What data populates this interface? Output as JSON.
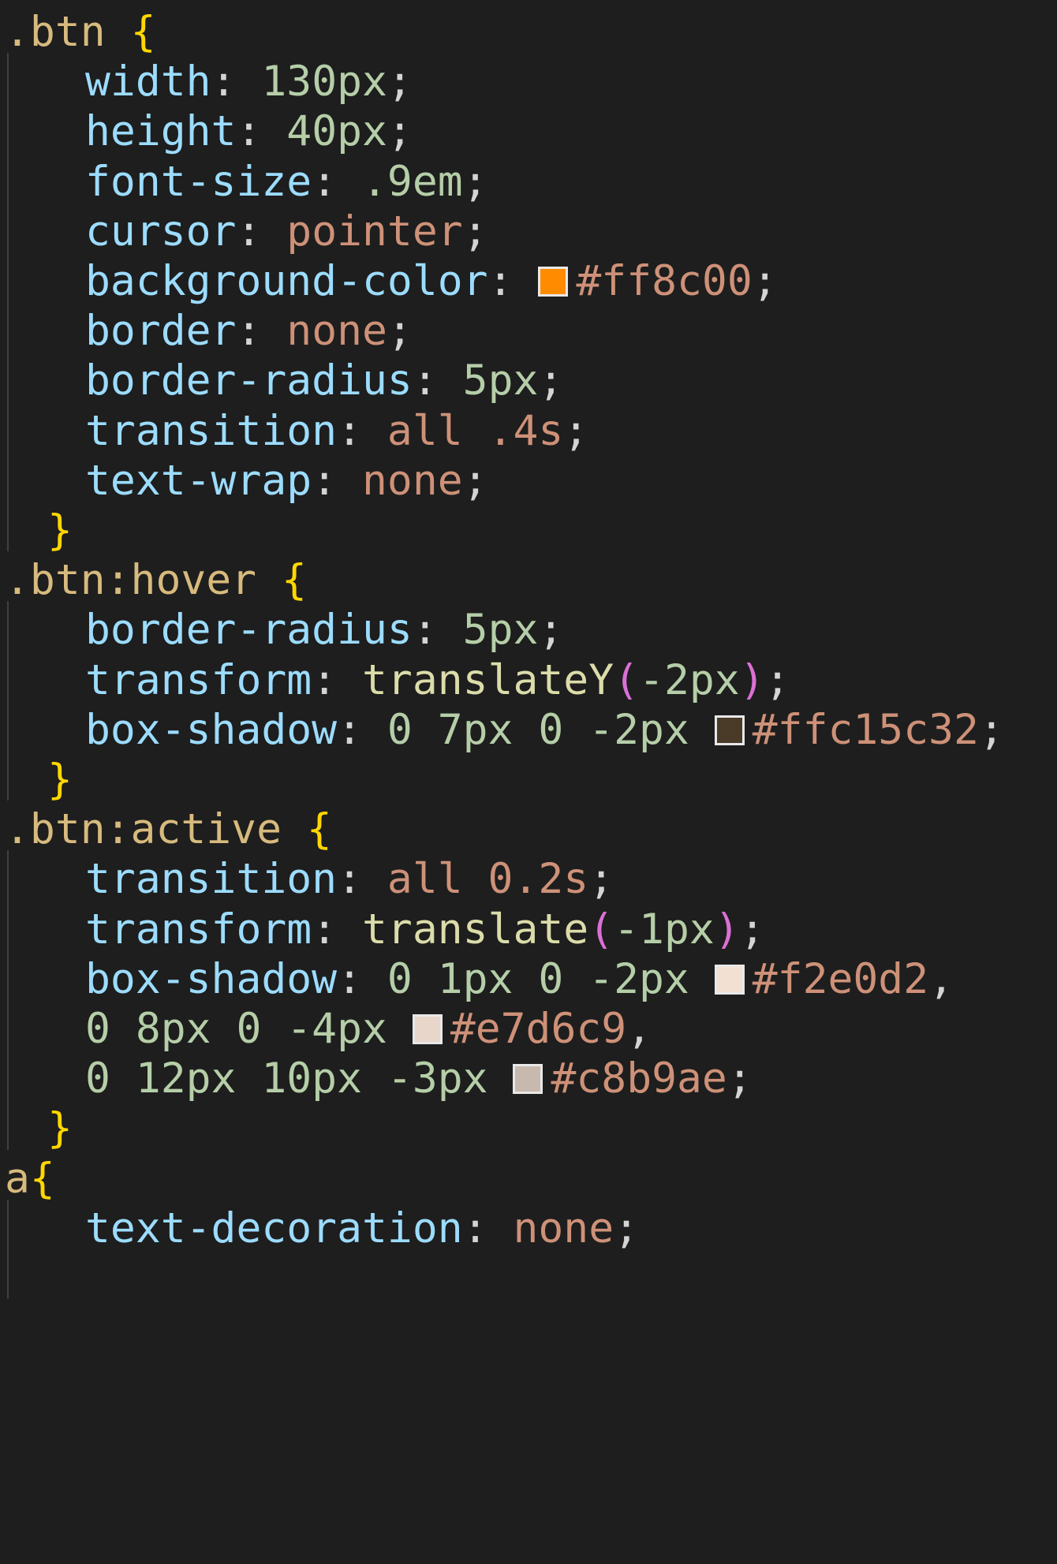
{
  "code": {
    "rules": [
      {
        "selector": ".btn",
        "open": "{",
        "decls": [
          {
            "prop": "width",
            "value": "130px",
            "type": "num"
          },
          {
            "prop": "height",
            "value": "40px",
            "type": "num"
          },
          {
            "prop": "font-size",
            "value": ".9em",
            "type": "num"
          },
          {
            "prop": "cursor",
            "value": "pointer",
            "type": "kw"
          },
          {
            "prop": "background-color",
            "value": "#ff8c00",
            "type": "color",
            "swatch": "#ff8c00"
          },
          {
            "prop": "border",
            "value": "none",
            "type": "kw"
          },
          {
            "prop": "border-radius",
            "value": "5px",
            "type": "num"
          },
          {
            "prop": "transition",
            "value": "all .4s",
            "type": "mixed"
          },
          {
            "prop": "text-wrap",
            "value": "none",
            "type": "kw"
          }
        ],
        "close": "}"
      },
      {
        "selector": ".btn:hover",
        "open": "{",
        "decls": [
          {
            "prop": "border-radius",
            "value": "5px",
            "type": "num"
          },
          {
            "prop": "transform",
            "value": "translateY(-2px)",
            "type": "func",
            "fn": "translateY",
            "arg": "-2px"
          },
          {
            "prop": "box-shadow",
            "value": "0 7px 0 -2px",
            "type": "color",
            "swatch": "#4a3a28",
            "hex": "#ffc15c32"
          }
        ],
        "close": "}"
      },
      {
        "selector": ".btn:active",
        "open": "{",
        "decls": [
          {
            "prop": "transition",
            "value": "all 0.2s",
            "type": "mixed"
          },
          {
            "prop": "transform",
            "value": "translate(-1px)",
            "type": "func",
            "fn": "translate",
            "arg": "-1px"
          },
          {
            "prop": "box-shadow",
            "value": "0 1px 0 -2px",
            "type": "color",
            "swatch": "#f2e0d2",
            "hex": "#f2e0d2",
            "sep": ","
          },
          {
            "prop": "",
            "value": "0 8px 0 -4px",
            "type": "color",
            "swatch": "#e7d6c9",
            "hex": "#e7d6c9",
            "sep": ","
          },
          {
            "prop": "",
            "value": "0 12px 10px -3px",
            "type": "color",
            "swatch": "#c8b9ae",
            "hex": "#c8b9ae"
          }
        ],
        "close": "}"
      },
      {
        "selector": "a",
        "open": "{",
        "decls": [
          {
            "prop": "text-decoration",
            "value": "none",
            "type": "kw"
          }
        ]
      }
    ]
  },
  "colors": {
    "background": "#1e1e1e",
    "selector": "#d7ba7d",
    "brace": "#ffd700",
    "paren": "#da70d6",
    "property": "#9cdcfe",
    "number": "#b5cea8",
    "keyword": "#ce9178",
    "function": "#dcdcaa"
  }
}
